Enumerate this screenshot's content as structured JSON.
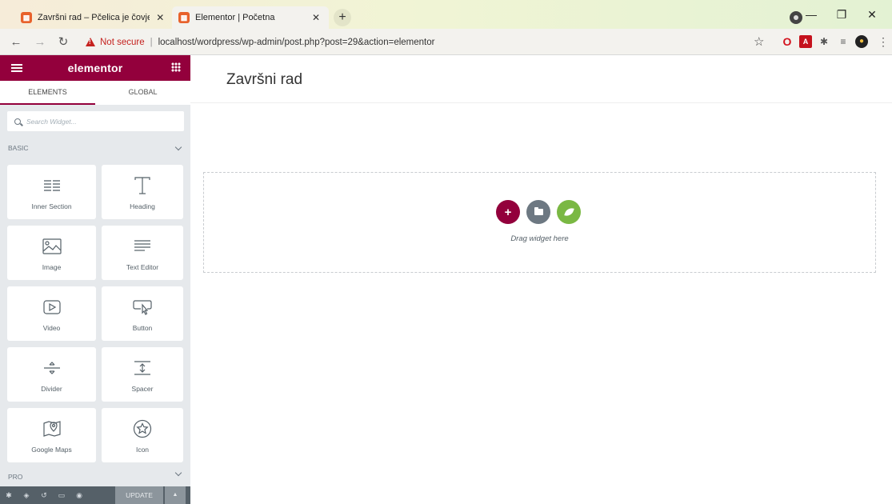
{
  "browser": {
    "tabs": [
      {
        "title": "Završni rad – Pčelica je čovjekove",
        "active": false,
        "favicon": "elementor-favicon"
      },
      {
        "title": "Elementor | Početna",
        "active": true,
        "favicon": "elementor-favicon"
      }
    ],
    "new_tab": "+",
    "address": {
      "security_label": "Not secure",
      "url": "localhost/wordpress/wp-admin/post.php?post=29&action=elementor"
    },
    "window_controls": [
      "minimize",
      "restore",
      "close"
    ],
    "extensions": [
      "opera-icon",
      "pdf-icon",
      "puzzle-icon",
      "queue-icon",
      "profile-avatar",
      "menu-icon"
    ]
  },
  "panel": {
    "logo": "elementor",
    "tabs": [
      "ELEMENTS",
      "GLOBAL"
    ],
    "active_tab": "ELEMENTS",
    "search_placeholder": "Search Widget...",
    "category_basic": "BASIC",
    "category_pro": "PRO",
    "widgets": [
      {
        "label": "Inner Section",
        "icon": "inner-section-icon"
      },
      {
        "label": "Heading",
        "icon": "heading-icon"
      },
      {
        "label": "Image",
        "icon": "image-icon"
      },
      {
        "label": "Text Editor",
        "icon": "text-editor-icon"
      },
      {
        "label": "Video",
        "icon": "video-icon"
      },
      {
        "label": "Button",
        "icon": "button-icon"
      },
      {
        "label": "Divider",
        "icon": "divider-icon"
      },
      {
        "label": "Spacer",
        "icon": "spacer-icon"
      },
      {
        "label": "Google Maps",
        "icon": "google-maps-icon"
      },
      {
        "label": "Icon",
        "icon": "star-icon"
      }
    ],
    "footer": {
      "update_label": "UPDATE",
      "icons": [
        "settings-icon",
        "navigator-icon",
        "history-icon",
        "responsive-icon",
        "preview-icon"
      ]
    }
  },
  "canvas": {
    "page_title": "Završni rad",
    "drop_text": "Drag widget here",
    "add_button": "+"
  },
  "colors": {
    "brand": "#93003c",
    "panel_bg": "#e6e9ec",
    "template_button": "#6d7882",
    "envato_button": "#7ab843",
    "not_secure": "#c5221f"
  }
}
